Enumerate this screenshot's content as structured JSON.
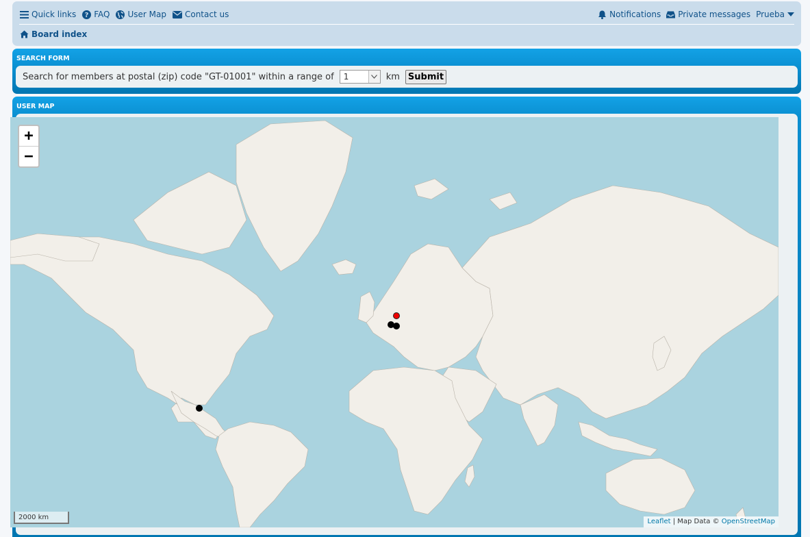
{
  "nav": {
    "quick_links": "Quick links",
    "faq": "FAQ",
    "user_map": "User Map",
    "contact": "Contact us",
    "notifications": "Notifications",
    "private_messages": "Private messages",
    "username": "Prueba",
    "board_index": "Board index"
  },
  "search_form": {
    "title": "Search form",
    "text": "Search for members at postal (zip) code \"GT-01001\" within a range of",
    "range_value": "1",
    "unit": "km",
    "submit_label": "Submit"
  },
  "user_map": {
    "title": "User map",
    "zoom_in": "+",
    "zoom_out": "−",
    "scale": "2000 km",
    "attribution": {
      "leaflet": "Leaflet",
      "sep": " | Map Data © ",
      "osm": "OpenStreetMap"
    },
    "markers": [
      {
        "type": "current",
        "color": "#e00000"
      },
      {
        "type": "member",
        "color": "#000000"
      },
      {
        "type": "member",
        "color": "#000000"
      },
      {
        "type": "member",
        "color": "#000000"
      }
    ]
  },
  "colors": {
    "nav_bg": "#cadceb",
    "link": "#105289",
    "panel_blue": "#0a8ed0",
    "water": "#aad3df",
    "land": "#f2efe9"
  }
}
